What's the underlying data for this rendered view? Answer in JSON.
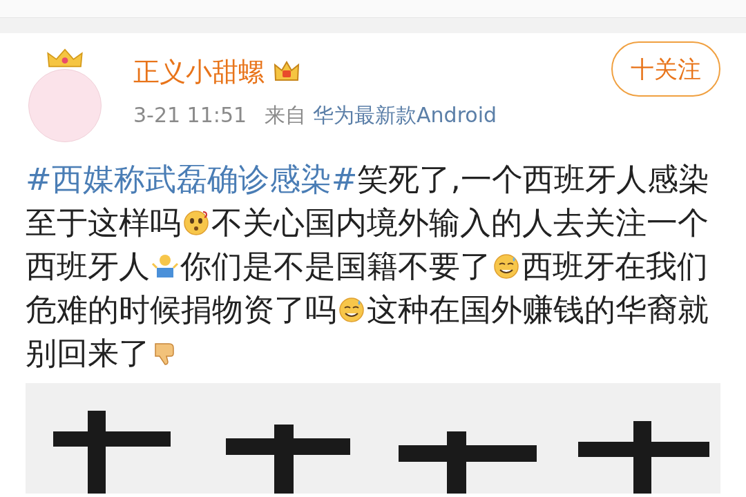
{
  "post": {
    "author": "正义小甜螺",
    "follow_button": "十关注",
    "time": "3-21 11:51",
    "source_prefix": "来自",
    "source": "华为最新款Android",
    "body_lines": [
      [
        {
          "kind": "hashtag",
          "text": "#西媒称武磊确诊感染#"
        },
        {
          "kind": "text",
          "text": "笑死了,一个西班牙人感染"
        }
      ],
      [
        {
          "kind": "text",
          "text": "至于这样吗"
        },
        {
          "kind": "emoji-thinking"
        },
        {
          "kind": "text",
          "text": "不关心国内境外输入的人去关注一个"
        }
      ],
      [
        {
          "kind": "text",
          "text": "西班牙人"
        },
        {
          "kind": "emoji-shrug"
        },
        {
          "kind": "text",
          "text": "你们是不是国籍不要了"
        },
        {
          "kind": "emoji-sweat"
        },
        {
          "kind": "text",
          "text": "西班牙在我们"
        }
      ],
      [
        {
          "kind": "text",
          "text": "危难的时候捐物资了吗"
        },
        {
          "kind": "emoji-sweat"
        },
        {
          "kind": "text",
          "text": "这种在国外赚钱的华裔就"
        }
      ],
      [
        {
          "kind": "text",
          "text": "别回来了"
        },
        {
          "kind": "emoji-thumbsdown"
        }
      ]
    ],
    "image": {
      "kind": "picture"
    }
  }
}
